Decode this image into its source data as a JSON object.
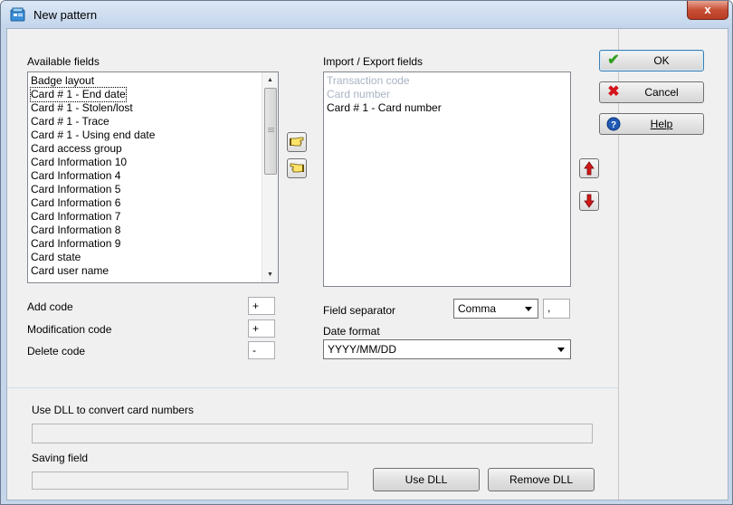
{
  "window": {
    "title": "New pattern",
    "close_glyph": "x"
  },
  "available_fields": {
    "label": "Available fields",
    "items": [
      "Badge layout",
      "Card # 1 - End date",
      "Card # 1 - Stolen/lost",
      "Card # 1 - Trace",
      "Card # 1 - Using end date",
      "Card access group",
      "Card Information 10",
      "Card Information 4",
      "Card Information 5",
      "Card Information 6",
      "Card Information 7",
      "Card Information 8",
      "Card Information 9",
      "Card state",
      "Card user name"
    ],
    "focused_index": 1
  },
  "import_export_fields": {
    "label": "Import / Export fields",
    "items": [
      {
        "text": "Transaction code",
        "state": "disabled"
      },
      {
        "text": "Card number",
        "state": "disabled"
      },
      {
        "text": "Card # 1 - Card number",
        "state": "normal"
      }
    ]
  },
  "codes": {
    "add_label": "Add code",
    "add_value": "+",
    "modification_label": "Modification code",
    "modification_value": "+",
    "delete_label": "Delete code",
    "delete_value": "-"
  },
  "field_separator": {
    "label": "Field separator",
    "selected": "Comma",
    "char": ","
  },
  "date_format": {
    "label": "Date format",
    "selected": "YYYY/MM/DD"
  },
  "dll": {
    "convert_label": "Use DLL to convert card numbers",
    "convert_value": "",
    "saving_label": "Saving field",
    "saving_value": "",
    "use_button": "Use DLL",
    "remove_button": "Remove DLL"
  },
  "side_buttons": {
    "ok": "OK",
    "cancel": "Cancel",
    "help": "Help"
  },
  "colors": {
    "ok_check": "#2e9e1c",
    "cancel_x": "#d4141c",
    "help_blue": "#1f5bb5",
    "arrow_red": "#d01818",
    "disabled_text": "#a9b4c4"
  }
}
